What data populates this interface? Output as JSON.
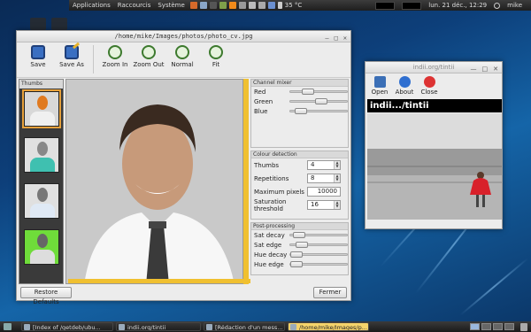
{
  "top_panel": {
    "menus": [
      "Applications",
      "Raccourcis",
      "Système"
    ],
    "temperature": "35 °C",
    "clock": "lun. 21 déc., 12:29",
    "user": "mike"
  },
  "main_window": {
    "title": "/home/mike/Images/photos/photo_cv.jpg",
    "toolbar": [
      {
        "label": "Save",
        "icon": "save-icon"
      },
      {
        "label": "Save As",
        "icon": "save-as-icon"
      },
      {
        "label": "Zoom In",
        "icon": "zoom-in-icon"
      },
      {
        "label": "Zoom Out",
        "icon": "zoom-out-icon"
      },
      {
        "label": "Normal",
        "icon": "zoom-normal-icon"
      },
      {
        "label": "Fit",
        "icon": "zoom-fit-icon"
      }
    ],
    "thumbs_header": "Thumbs",
    "channel_mixer": {
      "title": "Channel mixer",
      "sliders": [
        {
          "label": "Red",
          "value": 0.25
        },
        {
          "label": "Green",
          "value": 0.55
        },
        {
          "label": "Blue",
          "value": 0.1
        }
      ]
    },
    "colour_detection": {
      "title": "Colour detection",
      "thumbs_label": "Thumbs",
      "thumbs_value": "4",
      "repetitions_label": "Repetitions",
      "repetitions_value": "8",
      "max_pixels_label": "Maximum pixels",
      "max_pixels_value": "10000",
      "sat_threshold_label": "Saturation threshold",
      "sat_threshold_value": "16"
    },
    "post_processing": {
      "title": "Post-processing",
      "sliders": [
        {
          "label": "Sat decay",
          "value": 0.05
        },
        {
          "label": "Sat edge",
          "value": 0.12
        },
        {
          "label": "Hue decay",
          "value": 0.0
        },
        {
          "label": "Hue edge",
          "value": 0.0
        }
      ]
    },
    "restore_button": "Restore Defaults",
    "close_button": "Fermer"
  },
  "tintii_window": {
    "title": "indii.org/tintii",
    "toolbar": [
      {
        "label": "Open",
        "icon": "open-icon"
      },
      {
        "label": "About",
        "icon": "about-icon"
      },
      {
        "label": "Close",
        "icon": "close-icon"
      }
    ],
    "banner": "indii.../tintii"
  },
  "taskbar": {
    "tasks": [
      {
        "label": "[Index of /getdeb/ubu...",
        "active": false
      },
      {
        "label": "indii.org/tintii",
        "active": false
      },
      {
        "label": "[Rédaction d'un mess...",
        "active": false
      },
      {
        "label": "/home/mike/Images/p...",
        "active": true
      }
    ]
  },
  "colors": {
    "accent_yellow": "#f0c030",
    "selection_orange": "#e7a13b",
    "desktop_blue": "#0d3f7a"
  }
}
